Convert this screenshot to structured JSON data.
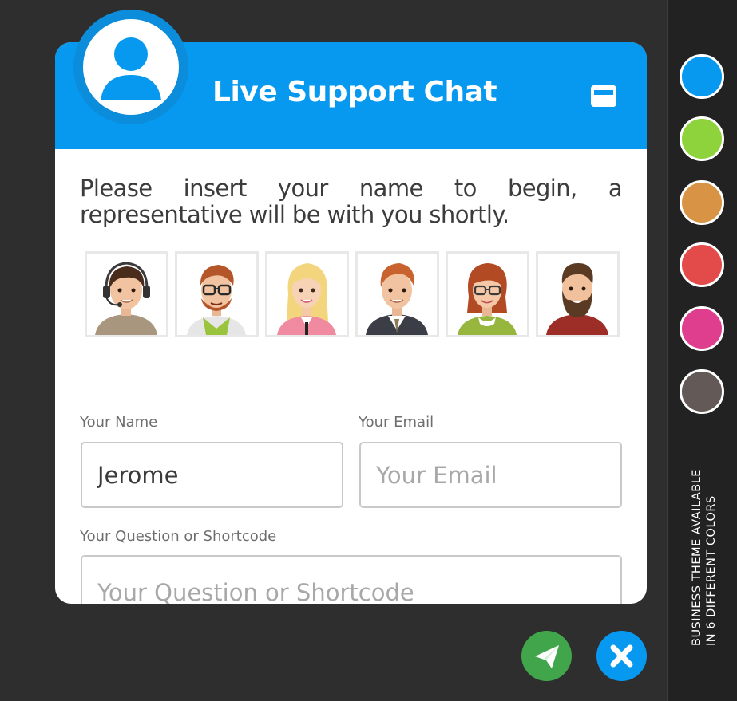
{
  "header": {
    "title": "Live Support Chat",
    "minimize_icon": "minimize-window-icon"
  },
  "intro_text": "Please insert your name to begin, a representative will be with you shortly.",
  "agents": [
    {
      "name": "agent-headset"
    },
    {
      "name": "agent-glasses-beard"
    },
    {
      "name": "agent-blonde"
    },
    {
      "name": "agent-suit"
    },
    {
      "name": "agent-redhead-glasses"
    },
    {
      "name": "agent-bearded"
    }
  ],
  "form": {
    "name_label": "Your Name",
    "name_value": "Jerome",
    "email_label": "Your Email",
    "email_placeholder": "Your Email",
    "question_label": "Your Question or Shortcode",
    "question_placeholder": "Your Question or Shortcode"
  },
  "actions": {
    "send_icon": "paper-plane-icon",
    "close_icon": "close-icon"
  },
  "theme_panel": {
    "caption_line1": "Business theme available",
    "caption_line2": "in 6 different colors",
    "colors": [
      "#0699ef",
      "#8ed33b",
      "#d89444",
      "#e34a4a",
      "#df3e8f",
      "#635956"
    ]
  },
  "colors": {
    "brand": "#0699ef",
    "send": "#41a64b",
    "close": "#0699ef"
  }
}
